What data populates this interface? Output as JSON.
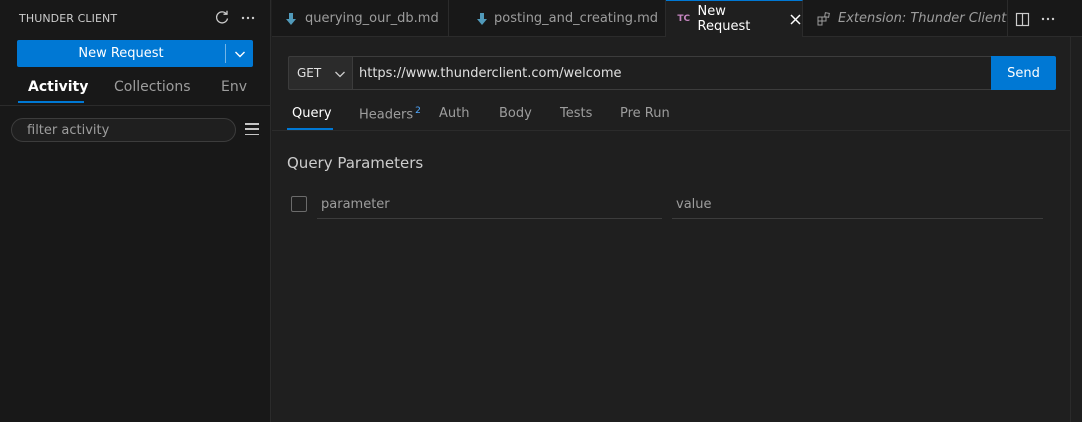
{
  "sidebar": {
    "title": "THUNDER CLIENT",
    "new_request_label": "New Request",
    "tabs": [
      {
        "label": "Activity",
        "active": true
      },
      {
        "label": "Collections",
        "active": false
      },
      {
        "label": "Env",
        "active": false
      }
    ],
    "filter_placeholder": "filter activity",
    "icons": [
      "refresh-icon",
      "more-icon",
      "chevron-down-icon",
      "menu-icon"
    ]
  },
  "editor_tabs": [
    {
      "label": "querying_our_db.md",
      "icon": "markdown-icon",
      "state": "inactive"
    },
    {
      "label": "posting_and_creating.md",
      "icon": "markdown-icon",
      "state": "dirty"
    },
    {
      "label": "New Request",
      "icon": "thunder-client-icon",
      "icon_text": "TC",
      "state": "active"
    },
    {
      "label": "Extension: Thunder Client",
      "icon": "extension-icon",
      "state": "preview"
    }
  ],
  "request": {
    "method": "GET",
    "url": "https://www.thunderclient.com/welcome",
    "send_label": "Send",
    "tabs": [
      {
        "label": "Query",
        "active": true
      },
      {
        "label": "Headers",
        "badge": "2",
        "active": false
      },
      {
        "label": "Auth",
        "active": false
      },
      {
        "label": "Body",
        "active": false
      },
      {
        "label": "Tests",
        "active": false
      },
      {
        "label": "Pre Run",
        "active": false
      }
    ],
    "query_section_title": "Query Parameters",
    "param_placeholder": "parameter",
    "value_placeholder": "value"
  },
  "colors": {
    "accent": "#0078d4",
    "background": "#1f1f1f",
    "sidebar": "#181818"
  }
}
